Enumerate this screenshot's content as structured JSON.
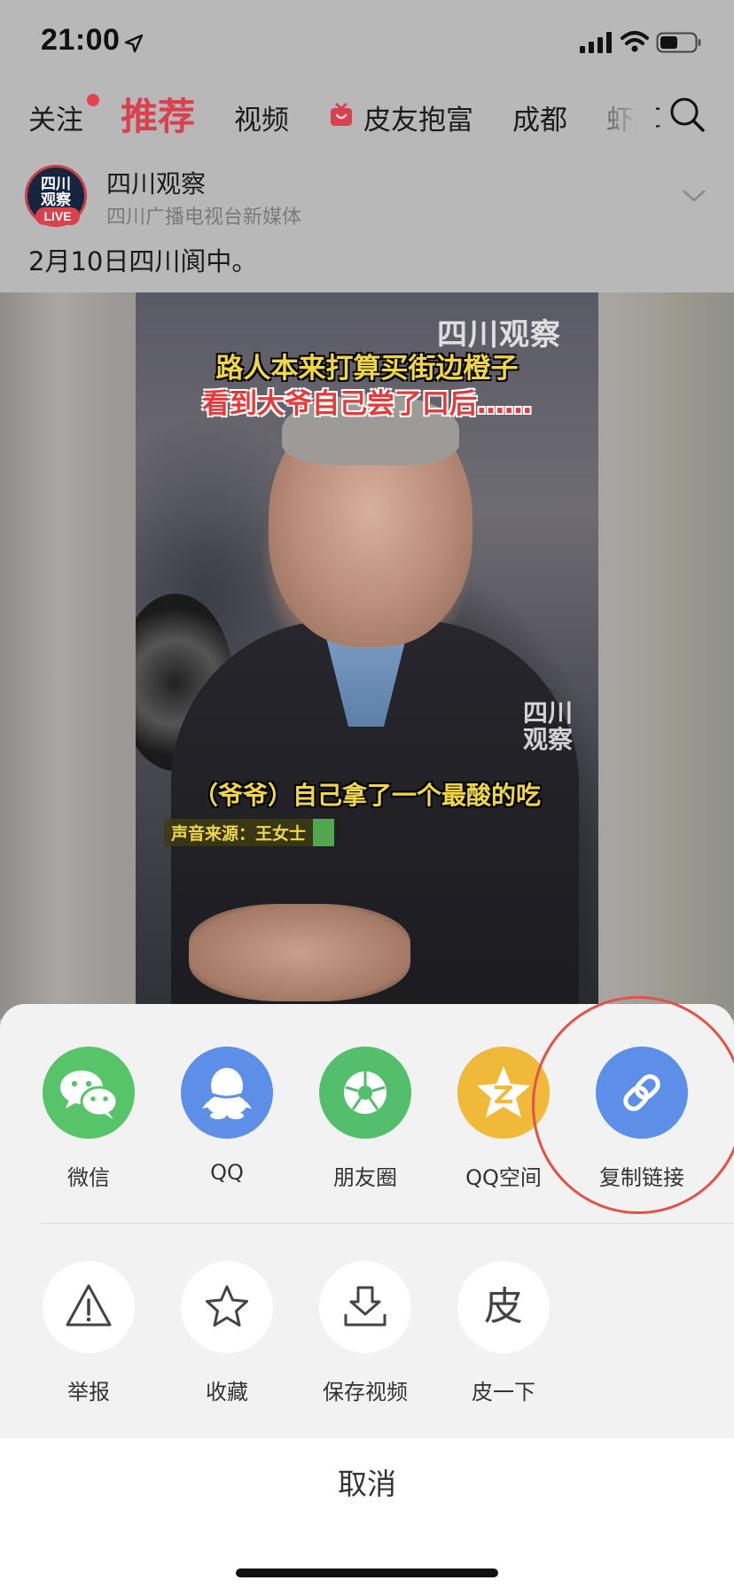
{
  "status_bar": {
    "time": "21:00"
  },
  "tabs": {
    "items": [
      {
        "label": "关注"
      },
      {
        "label": "推荐"
      },
      {
        "label": "视频"
      },
      {
        "label": "皮友抱富"
      },
      {
        "label": "成都"
      },
      {
        "label": "虾耳"
      }
    ]
  },
  "post": {
    "author": "四川观察",
    "author_desc": "四川广播电视台新媒体",
    "avatar_text": "四川观察",
    "live_badge": "LIVE",
    "text": "2月10日四川阆中。"
  },
  "video": {
    "watermark": "四川观察",
    "watermark_mid": "四川观察",
    "caption_top1": "路人本来打算买街边橙子",
    "caption_top2": "看到大爷自己尝了口后……",
    "caption_bottom": "（爷爷）自己拿了一个最酸的吃",
    "audio_source": "声音来源：王女士"
  },
  "share_sheet": {
    "row1": [
      {
        "label": "微信",
        "icon": "wechat-icon",
        "color": "#57c46a"
      },
      {
        "label": "QQ",
        "icon": "qq-icon",
        "color": "#5d8ee8"
      },
      {
        "label": "朋友圈",
        "icon": "moments-icon",
        "color": "#53be6c"
      },
      {
        "label": "QQ空间",
        "icon": "qzone-icon",
        "color": "#f0b93a"
      },
      {
        "label": "复制链接",
        "icon": "link-icon",
        "color": "#5d8ee8"
      }
    ],
    "row2": [
      {
        "label": "举报",
        "icon": "warning-icon"
      },
      {
        "label": "收藏",
        "icon": "star-icon"
      },
      {
        "label": "保存视频",
        "icon": "download-icon"
      },
      {
        "label": "皮一下",
        "icon": "pi-icon",
        "glyph": "皮"
      }
    ],
    "cancel_label": "取消"
  },
  "colors": {
    "accent": "#d9414e",
    "highlight": "#e25247"
  }
}
